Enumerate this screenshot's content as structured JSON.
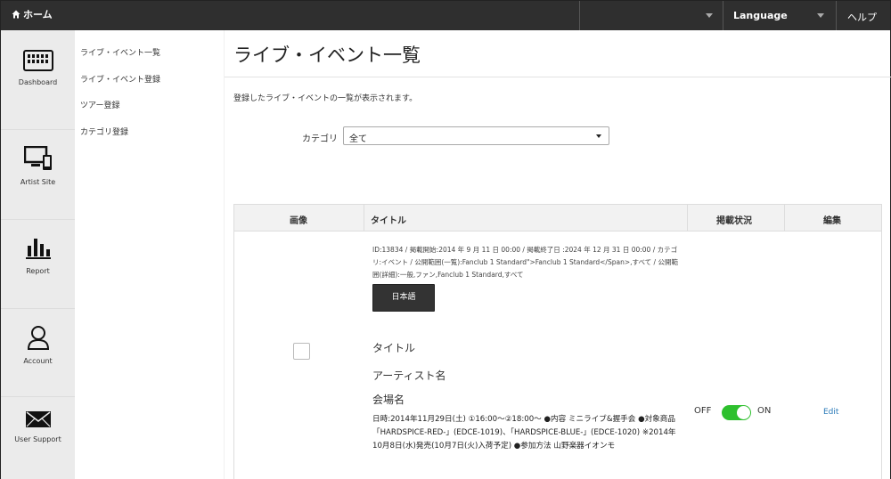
{
  "topbar": {
    "home_label": "ホーム",
    "language_label": "Language",
    "help_label": "ヘルプ"
  },
  "icon_nav": {
    "dashboard": "Dashboard",
    "artist_site": "Artist Site",
    "report": "Report",
    "account": "Account",
    "user_support": "User Support"
  },
  "sub_nav": {
    "items": [
      "ライブ・イベント一覧",
      "ライブ・イベント登録",
      "ツアー登録",
      "カテゴリ登録"
    ]
  },
  "main": {
    "title": "ライブ・イベント一覧",
    "description": "登録したライブ・イベントの一覧が表示されます。",
    "category_label": "カテゴリ",
    "category_value": "全て"
  },
  "table": {
    "headers": [
      "画像",
      "タイトル",
      "掲載状況",
      "編集"
    ],
    "row": {
      "info": "ID:13834 / 掲載開始:2014 年 9 月 11 日 00:00 / 掲載終了日 :2024 年 12 月 31 日 00:00 / カテゴリ:イベント / 公開範囲(一覧):Fanclub 1 Standard\">Fanclub 1 Standard</Span>,すべて / 公開範囲(詳細):一般,ファン,Fanclub 1 Standard,すべて",
      "lang_button": "日本語",
      "title": "タイトル",
      "artist": "アーティスト名",
      "venue": "会場名",
      "detail": "日時:2014年11月29日(土) ①16:00～②18:00～ ●内容 ミニライブ&握手会 ●対象商品 「HARDSPICE-RED-」(EDCE-1019)、「HARDSPICE-BLUE-」(EDCE-1020) ※2014年10月8日(水)発売(10月7日(火)入荷予定) ●参加方法 山野楽器イオンモ",
      "toggle_off": "OFF",
      "toggle_on": "ON",
      "edit": "Edit"
    }
  },
  "colors": {
    "topbar": "#2f2f2f",
    "icon_nav": "#ebebeb",
    "toggle_on": "#2ec02e",
    "link": "#2a7ab8"
  }
}
